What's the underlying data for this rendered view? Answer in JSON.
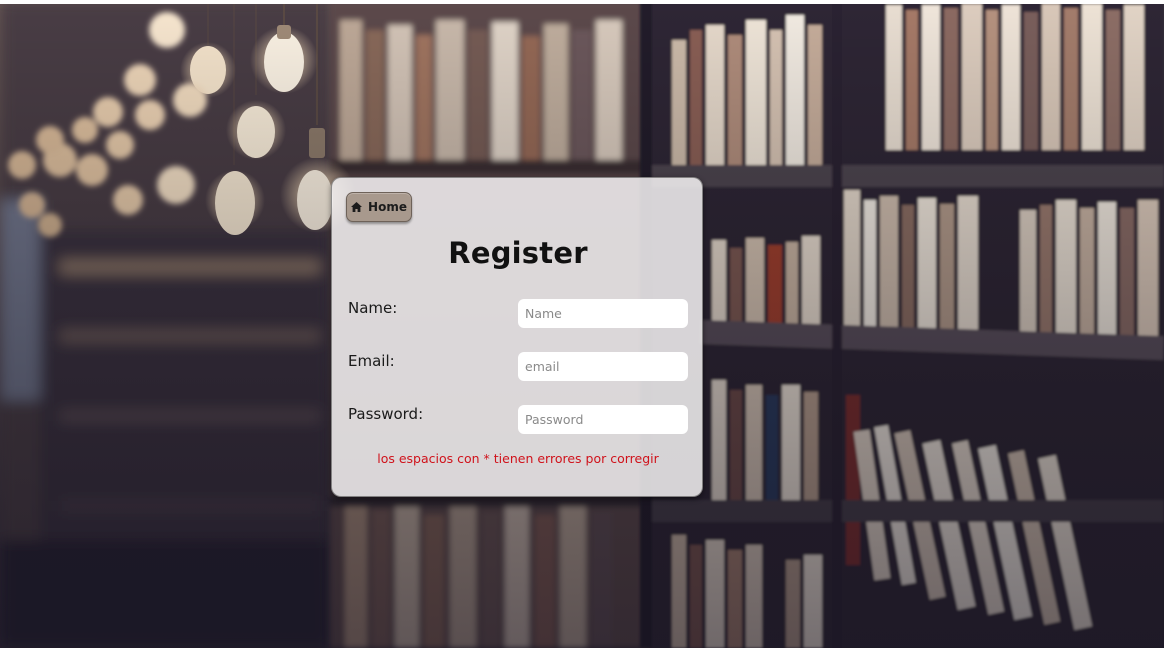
{
  "page": {
    "title": "Register",
    "background": "library-bookshelves-photo"
  },
  "nav": {
    "home_label": "Home",
    "home_icon": "home-icon"
  },
  "form": {
    "name": {
      "label": "Name:",
      "placeholder": "Name",
      "value": ""
    },
    "email": {
      "label": "Email:",
      "placeholder": "email",
      "value": ""
    },
    "password": {
      "label": "Password:",
      "placeholder": "Password",
      "value": ""
    }
  },
  "error_message": "los espacios con * tienen errores por corregir",
  "colors": {
    "error": "#d0121b",
    "home_button": "#a8998d",
    "card": "#f4f2f3"
  }
}
